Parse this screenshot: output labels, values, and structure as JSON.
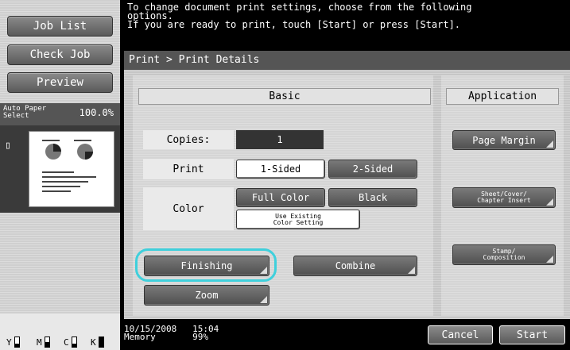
{
  "left_menu": {
    "job_list": "Job List",
    "check_job": "Check Job",
    "preview": "Preview",
    "paper_select": "Auto Paper\nSelect",
    "zoom": "100.0%"
  },
  "message": "To change document print settings, choose from the following\noptions.\nIf you are ready to print, touch [Start] or press [Start].",
  "breadcrumb": "Print > Print Details",
  "tabs": {
    "basic": "Basic",
    "application": "Application"
  },
  "basic": {
    "copies_label": "Copies:",
    "copies_value": "1",
    "print_label": "Print",
    "print_options": [
      "1-Sided",
      "2-Sided"
    ],
    "print_selected": "1-Sided",
    "color_label": "Color",
    "color_options": [
      "Full Color",
      "Black"
    ],
    "use_existing": "Use Existing\nColor Setting",
    "finishing": "Finishing",
    "combine": "Combine",
    "zoom": "Zoom"
  },
  "application": {
    "page_margin": "Page Margin",
    "sheet_cover": "Sheet/Cover/\nChapter Insert",
    "stamp": "Stamp/\nComposition"
  },
  "status": {
    "datetime": "10/15/2008   15:04",
    "memory": "Memory       99%"
  },
  "buttons": {
    "cancel": "Cancel",
    "start": "Start"
  },
  "toner": [
    {
      "label": "Y",
      "level": 0.3
    },
    {
      "label": "M",
      "level": 0.5
    },
    {
      "label": "C",
      "level": 0.3
    },
    {
      "label": "K",
      "level": 1.0
    }
  ],
  "colors": {
    "highlight": "#3fd0dc"
  }
}
